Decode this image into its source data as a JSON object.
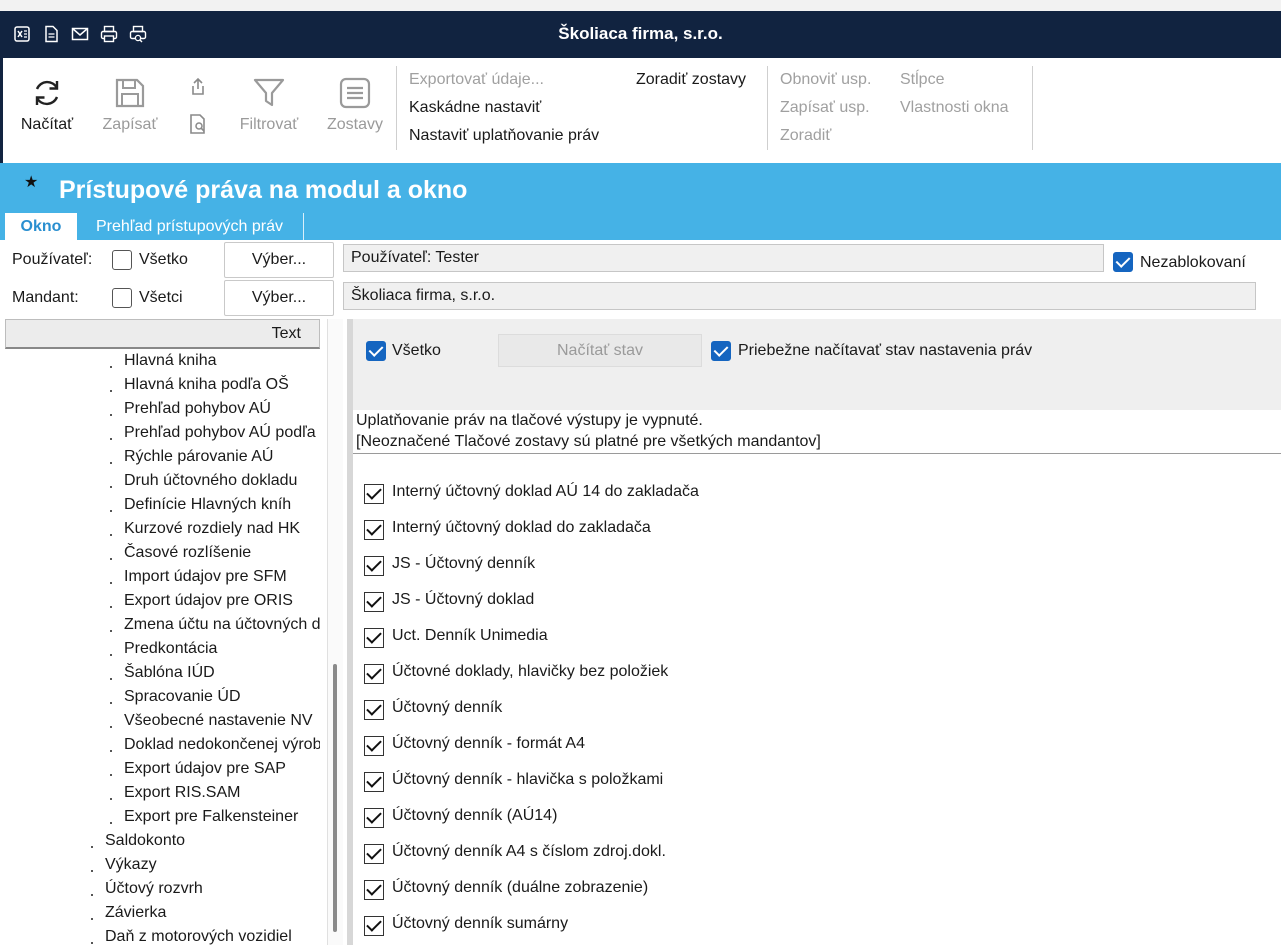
{
  "app": {
    "title": "Školiaca firma, s.r.o.",
    "title_icons": [
      "excel-icon",
      "document-icon",
      "mail-icon",
      "print-icon",
      "print-preview-icon"
    ]
  },
  "ribbon": {
    "buttons": [
      {
        "label": "Načítať",
        "icon": "refresh-icon",
        "enabled": true
      },
      {
        "label": "Zapísať",
        "icon": "save-icon",
        "enabled": false
      },
      {
        "label": "Filtrovať",
        "icon": "filter-icon",
        "enabled": false
      },
      {
        "label": "Zostavy",
        "icon": "list-icon",
        "enabled": false
      }
    ],
    "small_icons": [
      "export-icon",
      "preview-icon"
    ],
    "menu1": [
      {
        "label": "Exportovať údaje...",
        "enabled": false
      },
      {
        "label": "Kaskádne nastaviť",
        "enabled": true
      },
      {
        "label": "Nastaviť uplatňovanie práv",
        "enabled": true
      }
    ],
    "menu2": [
      {
        "label": "Zoradiť zostavy",
        "enabled": true
      }
    ],
    "menu3": [
      {
        "label": "Obnoviť usp.",
        "enabled": false
      },
      {
        "label": "Zapísať usp.",
        "enabled": false
      },
      {
        "label": "Zoradiť",
        "enabled": false
      }
    ],
    "menu4": [
      {
        "label": "Stĺpce",
        "enabled": false
      },
      {
        "label": "Vlastnosti okna",
        "enabled": false
      }
    ]
  },
  "page": {
    "title": "Prístupové práva na modul a okno",
    "tabs": [
      {
        "label": "Okno",
        "active": true
      },
      {
        "label": "Prehľad prístupových práv",
        "active": false
      }
    ]
  },
  "form": {
    "user_label": "Používateľ:",
    "user_all_label": "Všetko",
    "user_all_checked": false,
    "user_select_button": "Výber...",
    "user_value": "Používateľ: Tester",
    "unblocked_label": "Nezablokovaní",
    "unblocked_checked": true,
    "tenant_label": "Mandant:",
    "tenant_all_label": "Všetci",
    "tenant_all_checked": false,
    "tenant_select_button": "Výber...",
    "tenant_value": "Školiaca firma, s.r.o."
  },
  "tree": {
    "header": "Text",
    "items": [
      {
        "label": "Hlavná kniha",
        "level": 2
      },
      {
        "label": "Hlavná kniha podľa OŠ",
        "level": 2
      },
      {
        "label": "Prehľad pohybov AÚ",
        "level": 2
      },
      {
        "label": "Prehľad pohybov AÚ podľa",
        "level": 2
      },
      {
        "label": "Rýchle párovanie AÚ",
        "level": 2
      },
      {
        "label": "Druh účtovného dokladu",
        "level": 2
      },
      {
        "label": "Definície Hlavných kníh",
        "level": 2
      },
      {
        "label": "Kurzové rozdiely nad HK",
        "level": 2
      },
      {
        "label": "Časové rozlíšenie",
        "level": 2
      },
      {
        "label": "Import údajov pre SFM",
        "level": 2
      },
      {
        "label": "Export údajov pre ORIS",
        "level": 2
      },
      {
        "label": "Zmena účtu na účtovných d",
        "level": 2
      },
      {
        "label": "Predkontácia",
        "level": 2
      },
      {
        "label": "Šablóna IÚD",
        "level": 2
      },
      {
        "label": "Spracovanie ÚD",
        "level": 2
      },
      {
        "label": "Všeobecné nastavenie NV",
        "level": 2
      },
      {
        "label": "Doklad nedokončenej výrob",
        "level": 2
      },
      {
        "label": "Export údajov pre SAP",
        "level": 2
      },
      {
        "label": "Export RIS.SAM",
        "level": 2
      },
      {
        "label": "Export pre Falkensteiner",
        "level": 2
      },
      {
        "label": "Saldokonto",
        "level": 1
      },
      {
        "label": "Výkazy",
        "level": 1
      },
      {
        "label": "Účtový rozvrh",
        "level": 1
      },
      {
        "label": "Závierka",
        "level": 1
      },
      {
        "label": "Daň z motorových vozidiel",
        "level": 1
      }
    ]
  },
  "rights": {
    "all_label": "Všetko",
    "all_checked": true,
    "load_state_button": "Načítať stav",
    "live_label": "Priebežne načítavať stav nastavenia práv",
    "live_checked": true,
    "info_line1": "Uplatňovanie práv na tlačové výstupy je vypnuté.",
    "info_line2": "[Neoznačené Tlačové zostavy sú platné pre všetkých mandantov]",
    "reports": [
      {
        "label": "Interný účtovný doklad AÚ 14 do zakladača",
        "checked": true
      },
      {
        "label": "Interný účtovný doklad do zakladača",
        "checked": true
      },
      {
        "label": "JS - Účtovný denník",
        "checked": true
      },
      {
        "label": "JS - Účtovný doklad",
        "checked": true
      },
      {
        "label": "Uct. Denník Unimedia",
        "checked": true
      },
      {
        "label": "Účtovné doklady, hlavičky bez položiek",
        "checked": true
      },
      {
        "label": "Účtovný denník",
        "checked": true
      },
      {
        "label": "Účtovný denník - formát A4",
        "checked": true
      },
      {
        "label": "Účtovný denník - hlavička s položkami",
        "checked": true
      },
      {
        "label": "Účtovný denník (AÚ14)",
        "checked": true
      },
      {
        "label": "Účtovný denník A4 s číslom zdroj.dokl.",
        "checked": true
      },
      {
        "label": "Účtovný denník (duálne zobrazenie)",
        "checked": true
      },
      {
        "label": "Účtovný denník sumárny",
        "checked": true
      }
    ]
  }
}
